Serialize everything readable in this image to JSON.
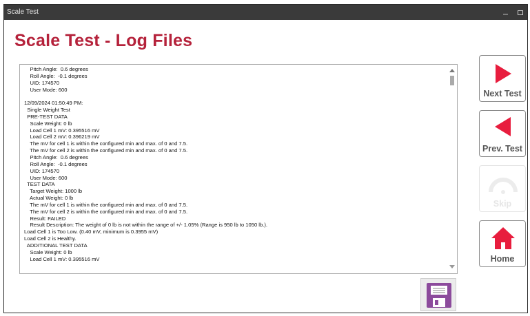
{
  "window": {
    "title": "Scale Test"
  },
  "page": {
    "title": "Scale Test - Log Files"
  },
  "log": {
    "lines": [
      "    Pitch Angle:  0.6 degrees",
      "    Roll Angle:  -0.1 degrees",
      "    UID: 174570",
      "    User Mode: 600",
      "",
      "12/09/2024 01:50:49 PM:",
      "  Single Weight Test",
      "  PRE-TEST DATA",
      "    Scale Weight: 0 lb",
      "    Load Cell 1 mV: 0.395516 mV",
      "    Load Cell 2 mV: 0.396219 mV",
      "    The mV for cell 1 is within the configured min and max. of 0 and 7.5.",
      "    The mV for cell 2 is within the configured min and max. of 0 and 7.5.",
      "    Pitch Angle:  0.6 degrees",
      "    Roll Angle:  -0.1 degrees",
      "    UID: 174570",
      "    User Mode: 600",
      "  TEST DATA",
      "    Target Weight: 1000 lb",
      "    Actual Weight: 0 lb",
      "    The mV for cell 1 is within the configured min and max. of 0 and 7.5.",
      "    The mV for cell 2 is within the configured min and max. of 0 and 7.5.",
      "    Result: FAILED",
      "    Result Description: The weight of 0 lb is not within the range of +/- 1.05% (Range is 950 lb to 1050 lb.).",
      "Load Cell 1 is Too Low. (0.40 mV, minimum is 0.3955 mV)",
      "Load Cell 2 is Healthy.",
      "  ADDITIONAL TEST DATA",
      "    Scale Weight: 0 lb",
      "    Load Cell 1 mV: 0.395516 mV"
    ]
  },
  "buttons": {
    "next": {
      "label": "Next Test",
      "icon": "play-right-icon",
      "color": "#e81d3e"
    },
    "prev": {
      "label": "Prev. Test",
      "icon": "play-left-icon",
      "color": "#e81d3e"
    },
    "skip": {
      "label": "Skip",
      "icon": "gauge-icon",
      "enabled": false
    },
    "home": {
      "label": "Home",
      "icon": "home-icon",
      "color": "#e81d3e"
    },
    "save": {
      "icon": "floppy-disk-icon",
      "color": "#8c4b9c"
    }
  }
}
